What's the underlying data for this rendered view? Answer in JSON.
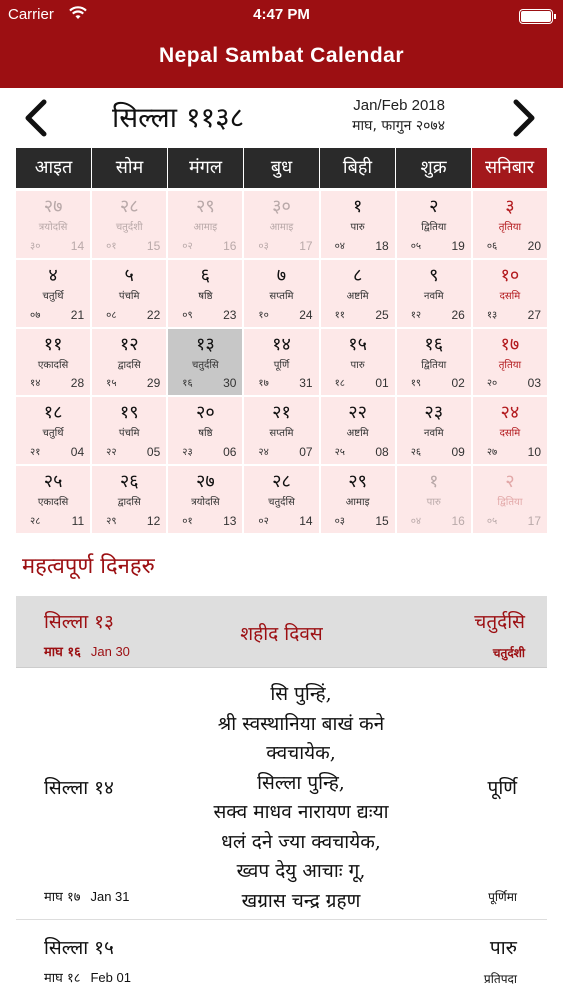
{
  "status": {
    "carrier": "Carrier",
    "time": "4:47 PM"
  },
  "app": {
    "title": "Nepal Sambat Calendar"
  },
  "calendar": {
    "month_title": "सिल्ला ११३८",
    "greg_month": "Jan/Feb 2018",
    "nep_month": "माघ, फागुन २०७४",
    "weekdays": [
      "आइत",
      "सोम",
      "मंगल",
      "बुध",
      "बिही",
      "शुक्र",
      "सनिबार"
    ],
    "days": [
      {
        "num": "२७",
        "tithi": "त्रयोदसि",
        "nday": "३०",
        "gday": "14"
      },
      {
        "num": "२८",
        "tithi": "चतुर्दशी",
        "nday": "०१",
        "gday": "15"
      },
      {
        "num": "२९",
        "tithi": "आमाइ",
        "nday": "०२",
        "gday": "16"
      },
      {
        "num": "३०",
        "tithi": "आमाइ",
        "nday": "०३",
        "gday": "17"
      },
      {
        "num": "१",
        "tithi": "पारु",
        "nday": "०४",
        "gday": "18"
      },
      {
        "num": "२",
        "tithi": "द्वितिया",
        "nday": "०५",
        "gday": "19"
      },
      {
        "num": "३",
        "tithi": "तृतिया",
        "nday": "०६",
        "gday": "20"
      },
      {
        "num": "४",
        "tithi": "चतुर्थि",
        "nday": "०७",
        "gday": "21"
      },
      {
        "num": "५",
        "tithi": "पंचमि",
        "nday": "०८",
        "gday": "22"
      },
      {
        "num": "६",
        "tithi": "षष्ठि",
        "nday": "०९",
        "gday": "23"
      },
      {
        "num": "७",
        "tithi": "सप्तमि",
        "nday": "१०",
        "gday": "24"
      },
      {
        "num": "८",
        "tithi": "अष्टमि",
        "nday": "११",
        "gday": "25"
      },
      {
        "num": "९",
        "tithi": "नवमि",
        "nday": "१२",
        "gday": "26"
      },
      {
        "num": "१०",
        "tithi": "दसमि",
        "nday": "१३",
        "gday": "27"
      },
      {
        "num": "११",
        "tithi": "एकादसि",
        "nday": "१४",
        "gday": "28"
      },
      {
        "num": "१२",
        "tithi": "द्वादसि",
        "nday": "१५",
        "gday": "29"
      },
      {
        "num": "१३",
        "tithi": "चतुर्दसि",
        "nday": "१६",
        "gday": "30"
      },
      {
        "num": "१४",
        "tithi": "पूर्णि",
        "nday": "१७",
        "gday": "31"
      },
      {
        "num": "१५",
        "tithi": "पारु",
        "nday": "१८",
        "gday": "01"
      },
      {
        "num": "१६",
        "tithi": "द्वितिया",
        "nday": "१९",
        "gday": "02"
      },
      {
        "num": "१७",
        "tithi": "तृतिया",
        "nday": "२०",
        "gday": "03"
      },
      {
        "num": "१८",
        "tithi": "चतुर्थि",
        "nday": "२१",
        "gday": "04"
      },
      {
        "num": "१९",
        "tithi": "पंचमि",
        "nday": "२२",
        "gday": "05"
      },
      {
        "num": "२०",
        "tithi": "षष्ठि",
        "nday": "२३",
        "gday": "06"
      },
      {
        "num": "२१",
        "tithi": "सप्तमि",
        "nday": "२४",
        "gday": "07"
      },
      {
        "num": "२२",
        "tithi": "अष्टमि",
        "nday": "२५",
        "gday": "08"
      },
      {
        "num": "२३",
        "tithi": "नवमि",
        "nday": "२६",
        "gday": "09"
      },
      {
        "num": "२४",
        "tithi": "दसमि",
        "nday": "२७",
        "gday": "10"
      },
      {
        "num": "२५",
        "tithi": "एकादसि",
        "nday": "२८",
        "gday": "11"
      },
      {
        "num": "२६",
        "tithi": "द्वादसि",
        "nday": "२९",
        "gday": "12"
      },
      {
        "num": "२७",
        "tithi": "त्रयोदसि",
        "nday": "०१",
        "gday": "13"
      },
      {
        "num": "२८",
        "tithi": "चतुर्दसि",
        "nday": "०२",
        "gday": "14"
      },
      {
        "num": "२९",
        "tithi": "आमाइ",
        "nday": "०३",
        "gday": "15"
      },
      {
        "num": "१",
        "tithi": "पारु",
        "nday": "०४",
        "gday": "16"
      },
      {
        "num": "२",
        "tithi": "द्वितिया",
        "nday": "०५",
        "gday": "17"
      }
    ]
  },
  "important": {
    "title": "महत्वपूर्ण दिनहरु",
    "head": {
      "left_main": "सिल्ला १३",
      "left_nep": "माघ १६",
      "left_greg": "Jan 30",
      "center": "शहीद दिवस",
      "right_main": "चतुर्दसि",
      "right_sub": "चतुर्दशी"
    },
    "row1": {
      "left_main": "सिल्ला १४",
      "left_nep": "माघ १७",
      "left_greg": "Jan 31",
      "desc": [
        "सि पुन्हिं,",
        "श्री स्वस्थानिया बाखं कने",
        "क्वचायेक,",
        "सिल्ला पुन्हि,",
        "सक्व माधव नारायण द्यःया",
        "धलं दने ज्या क्वचायेक,",
        "ख्वप देयु आचाः गू,",
        "खग्रास चन्द्र ग्रहण"
      ],
      "right_main": "पूर्णि",
      "right_sub": "पूर्णिमा"
    },
    "row2": {
      "left_main": "सिल्ला १५",
      "left_nep": "माघ १८",
      "left_greg": "Feb 01",
      "right_main": "पारु",
      "right_sub": "प्रतिपदा"
    }
  }
}
